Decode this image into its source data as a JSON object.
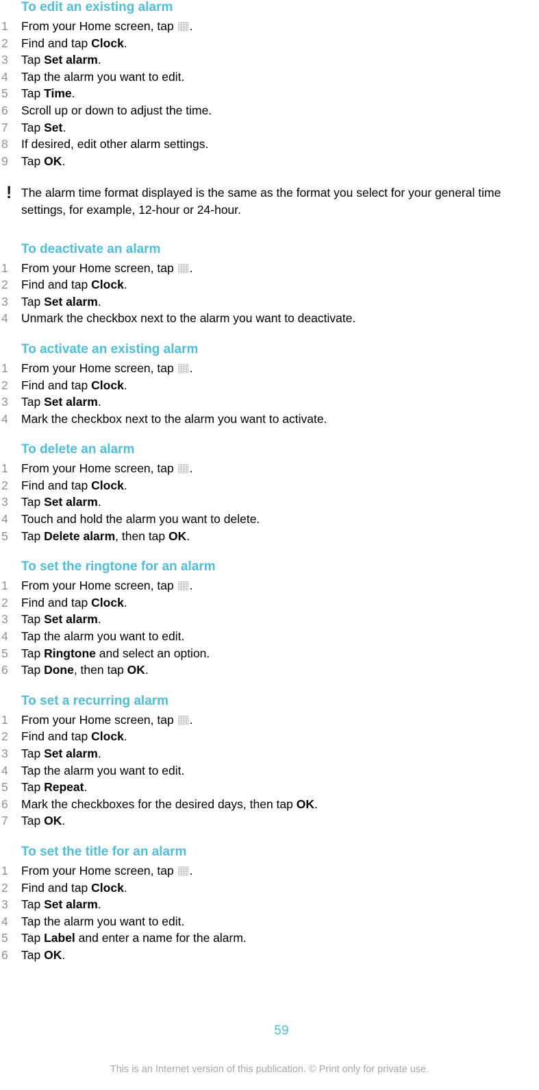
{
  "document": {
    "page_number": "59",
    "footer_note": "This is an Internet version of this publication. © Print only for private use.",
    "accent_color": "#4ac0e0",
    "number_color": "#919191",
    "footer_color": "#a8a8a8"
  },
  "icons": {
    "app_grid": "app-drawer-grid-icon",
    "note": "exclamation-mark-icon",
    "note_glyph": "!"
  },
  "sections": [
    {
      "heading": "To edit an existing alarm",
      "steps": [
        {
          "num": "1",
          "pre": "From your Home screen, tap ",
          "icon": "app-grid",
          "post": "."
        },
        {
          "num": "2",
          "pre": "Find and tap ",
          "bold": "Clock",
          "post": "."
        },
        {
          "num": "3",
          "pre": "Tap ",
          "bold": "Set alarm",
          "post": "."
        },
        {
          "num": "4",
          "pre": "Tap the alarm you want to edit.",
          "post": ""
        },
        {
          "num": "5",
          "pre": "Tap ",
          "bold": "Time",
          "post": "."
        },
        {
          "num": "6",
          "pre": "Scroll up or down to adjust the time.",
          "post": ""
        },
        {
          "num": "7",
          "pre": "Tap ",
          "bold": "Set",
          "post": "."
        },
        {
          "num": "8",
          "pre": "If desired, edit other alarm settings.",
          "post": ""
        },
        {
          "num": "9",
          "pre": "Tap ",
          "bold": "OK",
          "post": "."
        }
      ]
    },
    {
      "heading": "To deactivate an alarm",
      "steps": [
        {
          "num": "1",
          "pre": "From your Home screen, tap ",
          "icon": "app-grid",
          "post": "."
        },
        {
          "num": "2",
          "pre": "Find and tap ",
          "bold": "Clock",
          "post": "."
        },
        {
          "num": "3",
          "pre": "Tap ",
          "bold": "Set alarm",
          "post": "."
        },
        {
          "num": "4",
          "pre": "Unmark the checkbox next to the alarm you want to deactivate.",
          "post": ""
        }
      ]
    },
    {
      "heading": "To activate an existing alarm",
      "steps": [
        {
          "num": "1",
          "pre": "From your Home screen, tap ",
          "icon": "app-grid",
          "post": "."
        },
        {
          "num": "2",
          "pre": "Find and tap ",
          "bold": "Clock",
          "post": "."
        },
        {
          "num": "3",
          "pre": "Tap ",
          "bold": "Set alarm",
          "post": "."
        },
        {
          "num": "4",
          "pre": "Mark the checkbox next to the alarm you want to activate.",
          "post": ""
        }
      ]
    },
    {
      "heading": "To delete an alarm",
      "steps": [
        {
          "num": "1",
          "pre": "From your Home screen, tap ",
          "icon": "app-grid",
          "post": "."
        },
        {
          "num": "2",
          "pre": "Find and tap ",
          "bold": "Clock",
          "post": "."
        },
        {
          "num": "3",
          "pre": "Tap ",
          "bold": "Set alarm",
          "post": "."
        },
        {
          "num": "4",
          "pre": "Touch and hold the alarm you want to delete.",
          "post": ""
        },
        {
          "num": "5",
          "pre": "Tap ",
          "bold": "Delete alarm",
          "mid": ", then tap ",
          "bold2": "OK",
          "post": "."
        }
      ]
    },
    {
      "heading": "To set the ringtone for an alarm",
      "steps": [
        {
          "num": "1",
          "pre": "From your Home screen, tap ",
          "icon": "app-grid",
          "post": "."
        },
        {
          "num": "2",
          "pre": "Find and tap ",
          "bold": "Clock",
          "post": "."
        },
        {
          "num": "3",
          "pre": "Tap ",
          "bold": "Set alarm",
          "post": "."
        },
        {
          "num": "4",
          "pre": "Tap the alarm you want to edit.",
          "post": ""
        },
        {
          "num": "5",
          "pre": "Tap ",
          "bold": "Ringtone",
          "mid": " and select an option.",
          "post": ""
        },
        {
          "num": "6",
          "pre": "Tap ",
          "bold": "Done",
          "mid": ", then tap ",
          "bold2": "OK",
          "post": "."
        }
      ]
    },
    {
      "heading": "To set a recurring alarm",
      "steps": [
        {
          "num": "1",
          "pre": "From your Home screen, tap ",
          "icon": "app-grid",
          "post": "."
        },
        {
          "num": "2",
          "pre": "Find and tap ",
          "bold": "Clock",
          "post": "."
        },
        {
          "num": "3",
          "pre": "Tap ",
          "bold": "Set alarm",
          "post": "."
        },
        {
          "num": "4",
          "pre": "Tap the alarm you want to edit.",
          "post": ""
        },
        {
          "num": "5",
          "pre": "Tap ",
          "bold": "Repeat",
          "post": "."
        },
        {
          "num": "6",
          "pre": "Mark the checkboxes for the desired days, then tap ",
          "bold": "OK",
          "post": "."
        },
        {
          "num": "7",
          "pre": "Tap ",
          "bold": "OK",
          "post": "."
        }
      ]
    },
    {
      "heading": "To set the title for an alarm",
      "steps": [
        {
          "num": "1",
          "pre": "From your Home screen, tap ",
          "icon": "app-grid",
          "post": "."
        },
        {
          "num": "2",
          "pre": "Find and tap ",
          "bold": "Clock",
          "post": "."
        },
        {
          "num": "3",
          "pre": "Tap ",
          "bold": "Set alarm",
          "post": "."
        },
        {
          "num": "4",
          "pre": "Tap the alarm you want to edit.",
          "post": ""
        },
        {
          "num": "5",
          "pre": "Tap ",
          "bold": "Label",
          "mid": " and enter a name for the alarm.",
          "post": ""
        },
        {
          "num": "6",
          "pre": "Tap ",
          "bold": "OK",
          "post": "."
        }
      ]
    }
  ],
  "note": {
    "line1": "The alarm time format displayed is the same as the format you select for your general time",
    "line2": "settings, for example, 12-hour or 24-hour."
  }
}
